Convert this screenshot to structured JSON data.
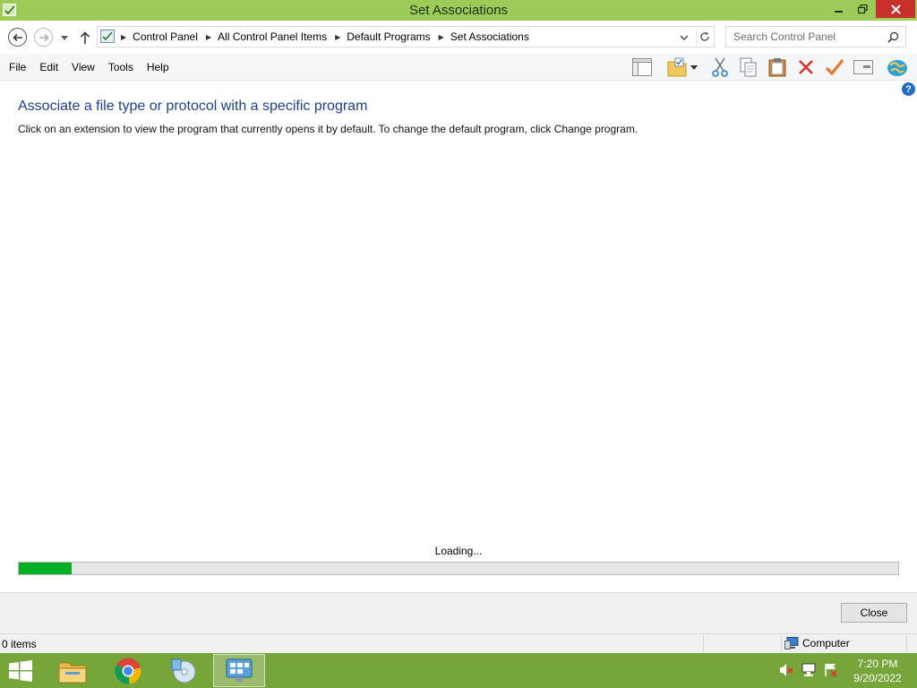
{
  "window": {
    "title": "Set Associations",
    "controls": [
      "minimize-icon",
      "restore-icon",
      "close-icon"
    ],
    "accent_color": "#9ccc57",
    "close_color": "#c7302b"
  },
  "nav": {
    "breadcrumbs": [
      "Control Panel",
      "All Control Panel Items",
      "Default Programs",
      "Set Associations"
    ],
    "search_placeholder": "Search Control Panel"
  },
  "menu": {
    "items": [
      "File",
      "Edit",
      "View",
      "Tools",
      "Help"
    ]
  },
  "toolbar": {
    "icons": [
      "layout-icon",
      "folder-options-icon",
      "dropdown-icon",
      "cut-icon",
      "copy-icon",
      "paste-icon",
      "delete-icon",
      "check-icon",
      "properties-icon",
      "globe-icon"
    ]
  },
  "content": {
    "heading": "Associate a file type or protocol with a specific program",
    "description": "Click on an extension to view the program that currently opens it by default. To change the default program, click Change program.",
    "loading_text": "Loading...",
    "progress_fraction": 0.06,
    "progress_color": "#06b025"
  },
  "footer": {
    "close_label": "Close"
  },
  "status": {
    "item_count": "0 items",
    "zone": "Computer"
  },
  "taskbar": {
    "apps": [
      "file-explorer-icon",
      "chrome-icon",
      "media-center-icon",
      "control-panel-icon"
    ],
    "tray": [
      "volume-muted-icon",
      "network-icon",
      "action-center-icon"
    ],
    "time": "7:20 PM",
    "date": "9/20/2022",
    "color": "#76a63a"
  }
}
